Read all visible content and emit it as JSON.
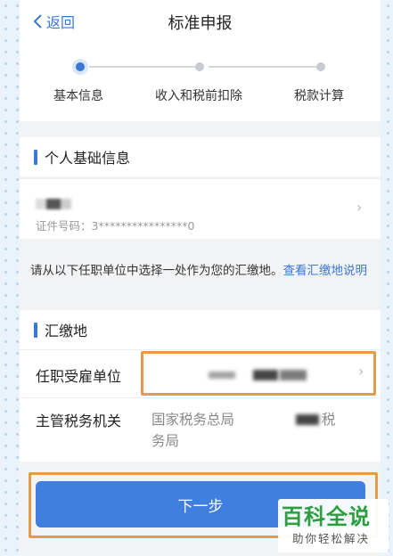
{
  "header": {
    "back_label": "返回",
    "title": "标准申报"
  },
  "steps": [
    {
      "label": "基本信息",
      "state": "active"
    },
    {
      "label": "收入和税前扣除",
      "state": "pending"
    },
    {
      "label": "税款计算",
      "state": "pending"
    }
  ],
  "personal_section": {
    "title": "个人基础信息",
    "id_number": "证件号码：3****************0"
  },
  "notice": {
    "text": "请从以下任职单位中选择一处作为您的汇缴地。",
    "link": "查看汇缴地说明"
  },
  "payment_section": {
    "title": "汇缴地",
    "employer_label": "任职受雇单位",
    "tax_office_label": "主管税务机关",
    "tax_office_value_prefix": "国家税务总局",
    "tax_office_value_suffix": "税",
    "tax_office_value_line2": "务局"
  },
  "next_button": "下一步",
  "watermark": {
    "title": "百科全说",
    "subtitle": "助你轻松解决"
  },
  "colors": {
    "accent": "#3a78d6",
    "highlight": "#e49a4c",
    "brand_green": "#2c9e3d"
  }
}
